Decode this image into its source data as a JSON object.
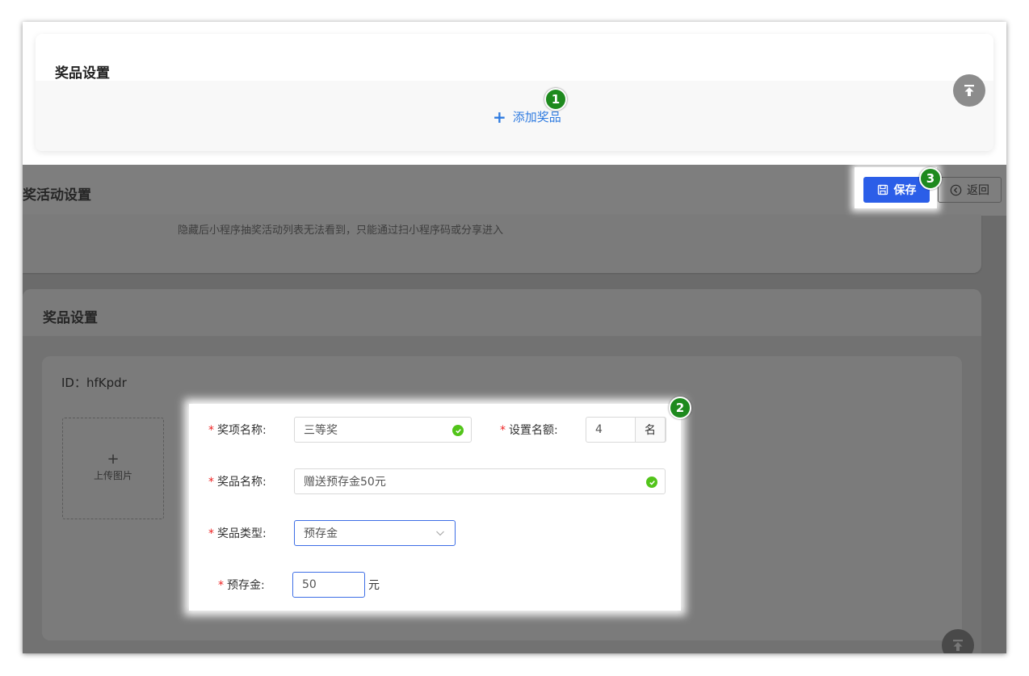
{
  "top_panel": {
    "title": "奖品设置",
    "add_prize_label": "添加奖品"
  },
  "badges": {
    "b1": "1",
    "b2": "2",
    "b3": "3"
  },
  "header": {
    "title": "奖活动设置",
    "save_label": "保存",
    "back_label": "返回"
  },
  "visibility_hint": "隐藏后小程序抽奖活动列表无法看到，只能通过扫小程序码或分享进入",
  "prize_section": {
    "title": "奖品设置",
    "prize_id": "ID：hfKpdr",
    "upload_plus": "+",
    "upload_label": "上传图片"
  },
  "form": {
    "required_mark": "*",
    "award_name_label": "奖项名称:",
    "award_name_value": "三等奖",
    "quota_label": "设置名额:",
    "quota_value": "4",
    "quota_unit": "名",
    "prize_name_label": "奖品名称:",
    "prize_name_value": "赠送预存金50元",
    "prize_type_label": "奖品类型:",
    "prize_type_value": "预存金",
    "deposit_label": "预存金:",
    "deposit_value": "50",
    "deposit_unit": "元"
  },
  "colors": {
    "primary": "#2b5ee8",
    "link": "#2f7be0",
    "badge": "#1e8a1e",
    "success": "#52c41a",
    "required": "#ee2222"
  }
}
